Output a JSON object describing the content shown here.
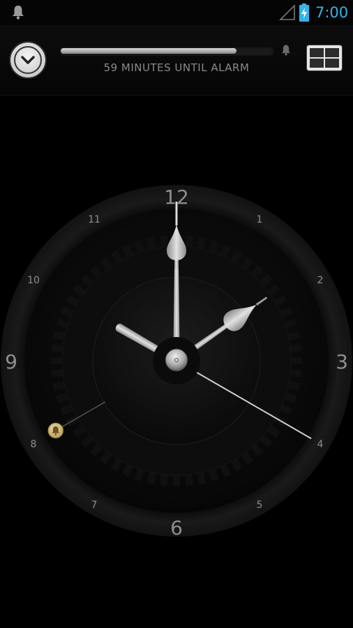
{
  "status_bar": {
    "time": "7:00",
    "icons": [
      "bell-icon",
      "signal-icon",
      "battery-charging-icon"
    ],
    "accent_color": "#33b5e5"
  },
  "header": {
    "collapse_icon": "chevron-down-icon",
    "progress_fraction": 0.83,
    "progress_icon": "bell-icon",
    "alarm_text": "59 MINUTES UNTIL ALARM",
    "layout_icon": "grid-icon"
  },
  "clock": {
    "time_shown": {
      "hour": 7,
      "minute": 0,
      "second": 20
    },
    "alarm_icon": "bell-icon",
    "alarm_hour": 8,
    "numerals": {
      "n12": "12",
      "n1": "1",
      "n2": "2",
      "n3": "3",
      "n4": "4",
      "n5": "5",
      "n6": "6",
      "n7": "7",
      "n8": "8",
      "n9": "9",
      "n10": "10",
      "n11": "11"
    }
  }
}
